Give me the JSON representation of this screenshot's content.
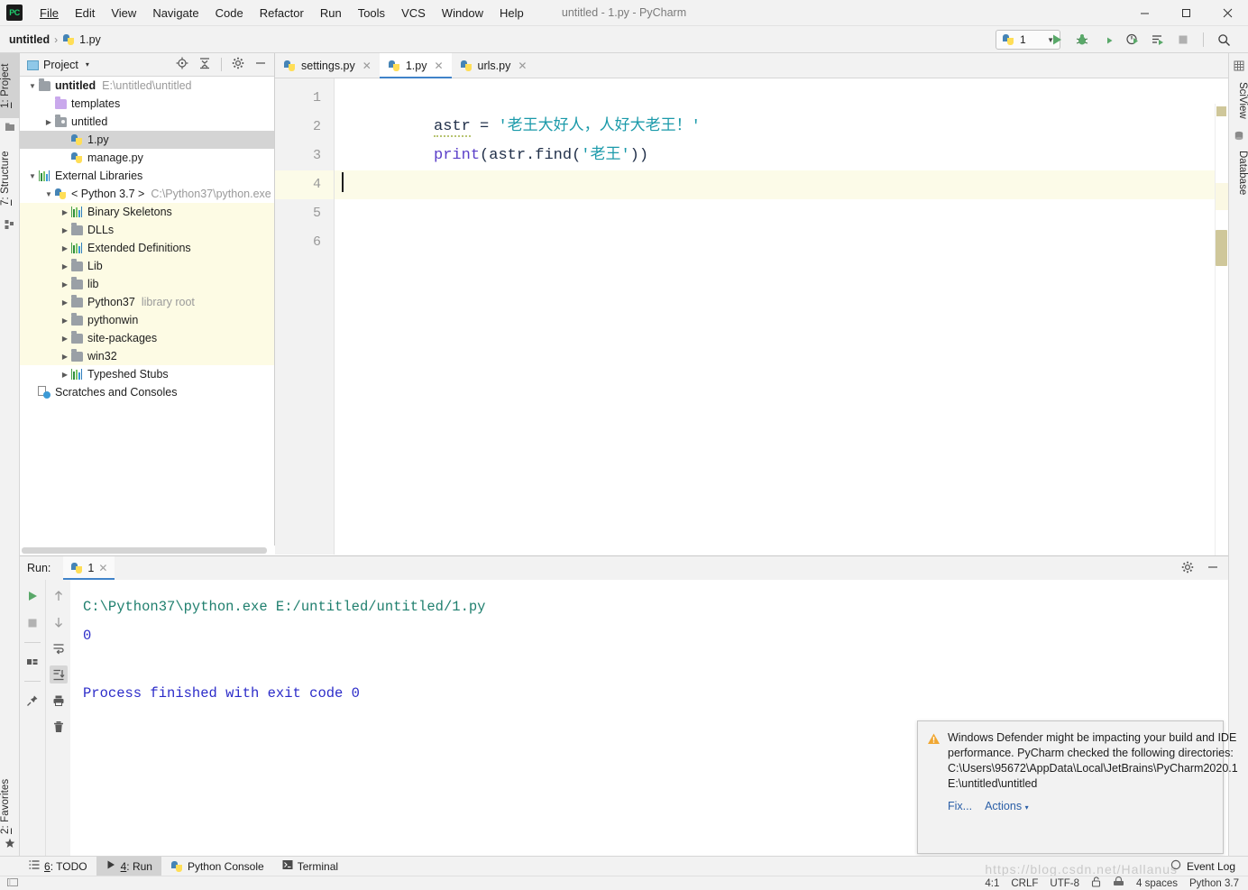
{
  "window": {
    "title": "untitled - 1.py - PyCharm",
    "logo_text": "PC",
    "minimize": "—",
    "maximize": "□",
    "close": "✕"
  },
  "menu": [
    {
      "label": "File"
    },
    {
      "label": "Edit"
    },
    {
      "label": "View"
    },
    {
      "label": "Navigate"
    },
    {
      "label": "Code"
    },
    {
      "label": "Refactor"
    },
    {
      "label": "Run"
    },
    {
      "label": "Tools"
    },
    {
      "label": "VCS"
    },
    {
      "label": "Window"
    },
    {
      "label": "Help"
    }
  ],
  "breadcrumb": {
    "project": "untitled",
    "separator": "›",
    "file": "1.py"
  },
  "run_config": {
    "name": "1",
    "caret": "▼"
  },
  "toolbar_icons": [
    {
      "name": "run-icon"
    },
    {
      "name": "debug-icon"
    },
    {
      "name": "run-coverage-icon"
    },
    {
      "name": "profile-icon"
    },
    {
      "name": "run-with-console-icon"
    },
    {
      "name": "stop-icon"
    },
    {
      "name": "search-everywhere-icon"
    }
  ],
  "left_strip": [
    {
      "label": "1: Project",
      "num": "1",
      "rest": ": Project",
      "icon": "project-icon",
      "selected": true
    },
    {
      "label": "7: Structure",
      "num": "7",
      "rest": ": Structure",
      "icon": "structure-icon",
      "selected": false
    },
    {
      "label": "2: Favorites",
      "num": "2",
      "rest": ": Favorites",
      "icon": "star-icon",
      "selected": false
    }
  ],
  "right_strip": [
    {
      "label": "SciView",
      "icon": "sciview-icon"
    },
    {
      "label": "Database",
      "icon": "database-icon"
    }
  ],
  "project_panel": {
    "title": "Project",
    "caret": "▾",
    "actions": [
      {
        "name": "locate-icon"
      },
      {
        "name": "collapse-all-icon"
      },
      {
        "name": "gear-icon"
      },
      {
        "name": "hide-icon"
      }
    ],
    "tree": [
      {
        "indent": 0,
        "arrow": "▼",
        "icon": "folder",
        "label": "untitled",
        "bold": true,
        "note": "E:\\untitled\\untitled",
        "state": "normal"
      },
      {
        "indent": 1,
        "arrow": "",
        "icon": "folder-purple",
        "label": "templates",
        "bold": false,
        "note": "",
        "state": "normal"
      },
      {
        "indent": 1,
        "arrow": "▶",
        "icon": "folder-dot",
        "label": "untitled",
        "bold": false,
        "note": "",
        "state": "normal"
      },
      {
        "indent": 2,
        "arrow": "",
        "icon": "py",
        "label": "1.py",
        "bold": false,
        "note": "",
        "state": "selected"
      },
      {
        "indent": 2,
        "arrow": "",
        "icon": "py",
        "label": "manage.py",
        "bold": false,
        "note": "",
        "state": "normal"
      },
      {
        "indent": 0,
        "arrow": "▼",
        "icon": "bars",
        "label": "External Libraries",
        "bold": false,
        "note": "",
        "state": "normal"
      },
      {
        "indent": 1,
        "arrow": "▼",
        "icon": "python",
        "label": "< Python 3.7 >",
        "bold": false,
        "note": "C:\\Python37\\python.exe",
        "state": "normal"
      },
      {
        "indent": 2,
        "arrow": "▶",
        "icon": "bars",
        "label": "Binary Skeletons",
        "bold": false,
        "note": "",
        "state": "highlight"
      },
      {
        "indent": 2,
        "arrow": "▶",
        "icon": "folder",
        "label": "DLLs",
        "bold": false,
        "note": "",
        "state": "highlight"
      },
      {
        "indent": 2,
        "arrow": "▶",
        "icon": "bars",
        "label": "Extended Definitions",
        "bold": false,
        "note": "",
        "state": "highlight"
      },
      {
        "indent": 2,
        "arrow": "▶",
        "icon": "folder",
        "label": "Lib",
        "bold": false,
        "note": "",
        "state": "highlight"
      },
      {
        "indent": 2,
        "arrow": "▶",
        "icon": "folder",
        "label": "lib",
        "bold": false,
        "note": "",
        "state": "highlight"
      },
      {
        "indent": 2,
        "arrow": "▶",
        "icon": "folder",
        "label": "Python37",
        "bold": false,
        "note": "library root",
        "state": "highlight"
      },
      {
        "indent": 2,
        "arrow": "▶",
        "icon": "folder",
        "label": "pythonwin",
        "bold": false,
        "note": "",
        "state": "highlight"
      },
      {
        "indent": 2,
        "arrow": "▶",
        "icon": "folder",
        "label": "site-packages",
        "bold": false,
        "note": "",
        "state": "highlight"
      },
      {
        "indent": 2,
        "arrow": "▶",
        "icon": "folder",
        "label": "win32",
        "bold": false,
        "note": "",
        "state": "highlight"
      },
      {
        "indent": 2,
        "arrow": "▶",
        "icon": "bars",
        "label": "Typeshed Stubs",
        "bold": false,
        "note": "",
        "state": "normal"
      },
      {
        "indent": 0,
        "arrow": "",
        "icon": "scratch",
        "label": "Scratches and Consoles",
        "bold": false,
        "note": "",
        "state": "normal"
      }
    ]
  },
  "editor": {
    "tabs": [
      {
        "label": "settings.py",
        "active": false,
        "close": "✕"
      },
      {
        "label": "1.py",
        "active": true,
        "close": "✕"
      },
      {
        "label": "urls.py",
        "active": false,
        "close": "✕"
      }
    ],
    "line_numbers": [
      "1",
      "2",
      "3",
      "4",
      "5",
      "6"
    ],
    "current_line": 4,
    "code": {
      "line1_var": "astr",
      "line1_op": " = ",
      "line1_str": "'老王大好人，人好大老王！'",
      "line2_kw": "print",
      "line2_open": "(astr.find(",
      "line2_str": "'老王'",
      "line2_close": "))"
    }
  },
  "run_panel": {
    "label": "Run:",
    "tab_name": "1",
    "tab_close": "✕",
    "actions": [
      {
        "name": "gear-icon"
      },
      {
        "name": "hide-icon"
      }
    ],
    "left_tools": [
      {
        "name": "rerun-icon"
      },
      {
        "name": "stop-icon"
      },
      {
        "name": "layout-icon"
      },
      {
        "name": "pin-icon"
      }
    ],
    "right_tools": [
      {
        "name": "up-arrow-icon"
      },
      {
        "name": "down-arrow-icon"
      },
      {
        "name": "soft-wrap-icon"
      },
      {
        "name": "scroll-to-end-icon"
      },
      {
        "name": "print-icon"
      },
      {
        "name": "trash-icon"
      }
    ],
    "output": [
      {
        "text": "C:\\Python37\\python.exe E:/untitled/untitled/1.py",
        "style": "teal"
      },
      {
        "text": "0",
        "style": "blue"
      },
      {
        "text": "",
        "style": "blue"
      },
      {
        "text": "Process finished with exit code 0",
        "style": "blue"
      }
    ]
  },
  "notification": {
    "icon": "warning-icon",
    "message": "Windows Defender might be impacting your build and IDE performance. PyCharm checked the following directories:\nC:\\Users\\95672\\AppData\\Local\\JetBrains\\PyCharm2020.1\nE:\\untitled\\untitled",
    "actions": [
      {
        "label": "Fix...",
        "caret": ""
      },
      {
        "label": "Actions",
        "caret": "▾"
      }
    ]
  },
  "bottom_tabs": [
    {
      "num": "6",
      "rest": ": TODO",
      "icon": "todo-icon",
      "selected": false
    },
    {
      "num": "4",
      "rest": ": Run",
      "icon": "run-icon",
      "selected": true
    },
    {
      "num": "",
      "rest": "Python Console",
      "icon": "python-icon",
      "selected": false
    },
    {
      "num": "",
      "rest": "Terminal",
      "icon": "terminal-icon",
      "selected": false
    }
  ],
  "event_log": {
    "label": "Event Log",
    "icon": "event-log-icon"
  },
  "status_bar": {
    "caret_position": "4:1",
    "line_separator": "CRLF",
    "encoding": "UTF-8",
    "lock_icon": "unlocked-icon",
    "branch_icon": "vcs-icon",
    "indent": "4 spaces",
    "interpreter": "Python 3.7"
  },
  "watermark": "https://blog.csdn.net/Hallanus",
  "colors": {
    "accent": "#4083c9",
    "string": "#1b9aaa",
    "keyword": "#5a3ec8",
    "console_blue": "#2c2cc9",
    "console_teal": "#1f7f6e",
    "selection": "#d4d4d4",
    "highlight": "#fdfbe4"
  }
}
